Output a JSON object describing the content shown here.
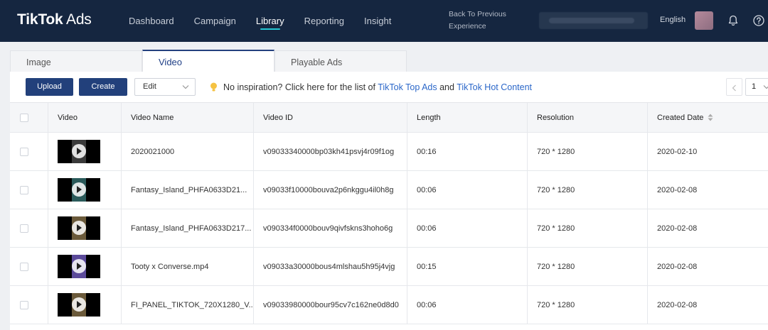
{
  "brand": {
    "name_bold": "TikTok",
    "name_light": " Ads"
  },
  "nav": {
    "items": [
      {
        "label": "Dashboard",
        "active": false
      },
      {
        "label": "Campaign",
        "active": false
      },
      {
        "label": "Library",
        "active": true
      },
      {
        "label": "Reporting",
        "active": false
      },
      {
        "label": "Insight",
        "active": false
      }
    ],
    "back_link": "Back To Previous Experience",
    "language": "English"
  },
  "tabs": [
    {
      "label": "Image",
      "active": false
    },
    {
      "label": "Video",
      "active": true
    },
    {
      "label": "Playable Ads",
      "active": false
    }
  ],
  "toolbar": {
    "upload_label": "Upload",
    "create_label": "Create",
    "edit_label": "Edit",
    "tip_text": "No inspiration? Click here for the list of ",
    "tip_link1": "TikTok Top Ads",
    "tip_and": " and ",
    "tip_link2": "TikTok Hot Content",
    "page_number": "1"
  },
  "table": {
    "columns": [
      "Video",
      "Video Name",
      "Video ID",
      "Length",
      "Resolution",
      "Created Date"
    ],
    "rows": [
      {
        "name": "2020021000",
        "id": "v09033340000bp03kh41psvj4r09f1og",
        "length": "00:16",
        "resolution": "720 * 1280",
        "date": "2020-02-10",
        "thumb_color": "#3a3a3a"
      },
      {
        "name": "Fantasy_Island_PHFA0633D21...",
        "id": "v09033f10000bouva2p6nkggu4il0h8g",
        "length": "00:06",
        "resolution": "720 * 1280",
        "date": "2020-02-08",
        "thumb_color": "#2a5a5a"
      },
      {
        "name": "Fantasy_Island_PHFA0633D217...",
        "id": "v090334f0000bouv9qivfskns3hoho6g",
        "length": "00:06",
        "resolution": "720 * 1280",
        "date": "2020-02-08",
        "thumb_color": "#6b5a3a"
      },
      {
        "name": "Tooty x Converse.mp4",
        "id": "v09033a30000bous4mlshau5h95j4vjg",
        "length": "00:15",
        "resolution": "720 * 1280",
        "date": "2020-02-08",
        "thumb_color": "#5b4a9a"
      },
      {
        "name": "FI_PANEL_TIKTOK_720X1280_V...",
        "id": "v09033980000bour95cv7c162ne0d8d0",
        "length": "00:06",
        "resolution": "720 * 1280",
        "date": "2020-02-08",
        "thumb_color": "#6b5a3a"
      }
    ]
  },
  "colors": {
    "nav_bg": "#152640",
    "primary": "#22407b",
    "link": "#2b67c9",
    "active_underline": "#25c8d4"
  }
}
